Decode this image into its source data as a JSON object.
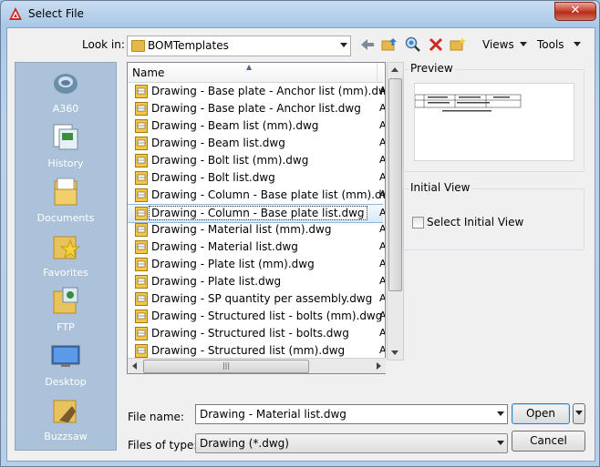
{
  "window": {
    "title": "Select File",
    "close_glyph": "✕"
  },
  "toolbar": {
    "look_in_label": "Look in:",
    "look_in_value": "BOMTemplates",
    "views_label": "Views",
    "tools_label": "Tools",
    "icons": [
      "back-arrow-icon",
      "folder-up-icon",
      "search-web-icon",
      "delete-icon",
      "new-folder-icon"
    ]
  },
  "places": [
    {
      "label": "A360",
      "icon": "a360-icon"
    },
    {
      "label": "History",
      "icon": "history-icon"
    },
    {
      "label": "Documents",
      "icon": "documents-icon"
    },
    {
      "label": "Favorites",
      "icon": "favorites-icon"
    },
    {
      "label": "FTP",
      "icon": "ftp-icon"
    },
    {
      "label": "Desktop",
      "icon": "desktop-icon"
    },
    {
      "label": "Buzzsaw",
      "icon": "buzzsaw-icon"
    }
  ],
  "file_list": {
    "column_name": "Name",
    "truncated_col_char": "A",
    "selected_index": 7,
    "files": [
      "Drawing - Base plate - Anchor list (mm).dwg",
      "Drawing - Base plate - Anchor list.dwg",
      "Drawing - Beam list (mm).dwg",
      "Drawing - Beam list.dwg",
      "Drawing - Bolt list (mm).dwg",
      "Drawing - Bolt list.dwg",
      "Drawing - Column - Base plate list (mm).dwg",
      "Drawing - Column - Base plate list.dwg",
      "Drawing - Material list (mm).dwg",
      "Drawing - Material list.dwg",
      "Drawing - Plate list (mm).dwg",
      "Drawing - Plate list.dwg",
      "Drawing - SP quantity per assembly.dwg",
      "Drawing - Structured list - bolts (mm).dwg",
      "Drawing - Structured list - bolts.dwg",
      "Drawing - Structured list (mm).dwg"
    ]
  },
  "preview": {
    "title": "Preview"
  },
  "initial_view": {
    "title": "Initial View",
    "checkbox_label": "Select Initial View",
    "checked": false
  },
  "bottom": {
    "file_name_label": "File name:",
    "file_name_value": "Drawing - Material list.dwg",
    "files_of_type_label": "Files of type:",
    "files_of_type_value": "Drawing (*.dwg)",
    "open_label": "Open",
    "cancel_label": "Cancel"
  },
  "colors": {
    "accent": "#3c7fb1",
    "places_bg": "#abc2da",
    "selection": "#dbe9f6"
  }
}
